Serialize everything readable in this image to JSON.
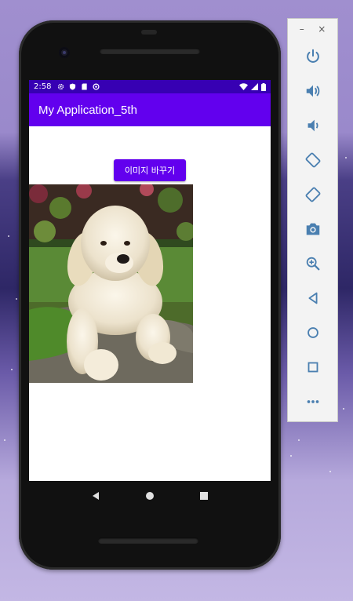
{
  "status_bar": {
    "time": "2:58"
  },
  "app_bar": {
    "title": "My Application_5th"
  },
  "main": {
    "change_image_button": "이미지 바꾸기"
  },
  "colors": {
    "primary": "#6200ee",
    "primary_dark": "#3700b3",
    "panel_icon": "#4a7fb0"
  },
  "emulator_panel": {
    "minimize_label": "–",
    "close_label": "×",
    "tools": [
      "power-icon",
      "volume-up-icon",
      "volume-down-icon",
      "rotate-left-icon",
      "rotate-right-icon",
      "camera-icon",
      "zoom-icon",
      "back-icon",
      "home-icon",
      "overview-icon",
      "more-icon"
    ]
  }
}
